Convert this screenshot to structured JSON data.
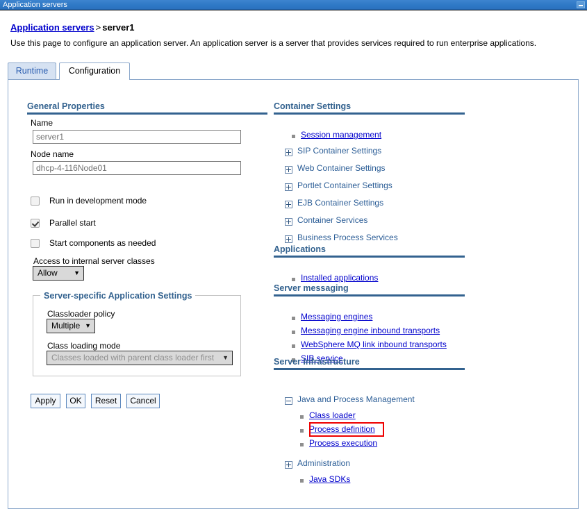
{
  "window": {
    "title": "Application servers",
    "minimize_label": "minimize"
  },
  "breadcrumb": {
    "parent": "Application servers",
    "separator": ">",
    "current": "server1"
  },
  "description": "Use this page to configure an application server. An application server is a server that provides services required to run enterprise applications.",
  "tabs": [
    {
      "label": "Runtime",
      "active": false
    },
    {
      "label": "Configuration",
      "active": true
    }
  ],
  "left_column": {
    "general_properties_heading": "General Properties",
    "name_label": "Name",
    "name_value": "server1",
    "node_name_label": "Node name",
    "node_name_value": "dhcp-4-116Node01",
    "checkboxes": [
      {
        "label": "Run in development mode",
        "checked": false
      },
      {
        "label": "Parallel start",
        "checked": true
      },
      {
        "label": "Start components as needed",
        "checked": false
      }
    ],
    "access_label": "Access to internal server classes",
    "access_value": "Allow",
    "fieldset_legend": "Server-specific Application Settings",
    "classloader_policy_label": "Classloader policy",
    "classloader_policy_value": "Multiple",
    "class_loading_mode_label": "Class loading mode",
    "class_loading_mode_value": "Classes loaded with parent class loader first",
    "buttons": [
      {
        "label": "Apply"
      },
      {
        "label": "OK"
      },
      {
        "label": "Reset"
      },
      {
        "label": "Cancel"
      }
    ]
  },
  "right_column": {
    "container_settings": {
      "heading": "Container Settings",
      "links": [
        {
          "label": "Session management"
        }
      ],
      "tree_items": [
        {
          "label": "SIP Container Settings",
          "expanded": false
        },
        {
          "label": "Web Container Settings",
          "expanded": false
        },
        {
          "label": "Portlet Container Settings",
          "expanded": false
        },
        {
          "label": "EJB Container Settings",
          "expanded": false
        },
        {
          "label": "Container Services",
          "expanded": false
        },
        {
          "label": "Business Process Services",
          "expanded": false
        }
      ]
    },
    "applications": {
      "heading": "Applications",
      "links": [
        {
          "label": "Installed applications"
        }
      ]
    },
    "server_messaging": {
      "heading": "Server messaging",
      "links": [
        {
          "label": "Messaging engines"
        },
        {
          "label": "Messaging engine inbound transports"
        },
        {
          "label": "WebSphere MQ link inbound transports"
        },
        {
          "label": "SIB service"
        }
      ]
    },
    "server_infrastructure": {
      "heading": "Server Infrastructure",
      "java_process_management": {
        "label": "Java and Process Management",
        "expanded": true
      },
      "java_process_links": [
        {
          "label": "Class loader",
          "highlighted": false
        },
        {
          "label": "Process definition",
          "highlighted": true
        },
        {
          "label": "Process execution",
          "highlighted": false
        }
      ],
      "administration": {
        "label": "Administration",
        "expanded": false
      },
      "administration_links": [
        {
          "label": "Java SDKs"
        }
      ]
    }
  },
  "colors": {
    "titlebar": "#2f79c6",
    "link": "#0000cc",
    "heading": "#33628f",
    "tree_text": "#2b5d96",
    "highlight": "#ee0000"
  }
}
